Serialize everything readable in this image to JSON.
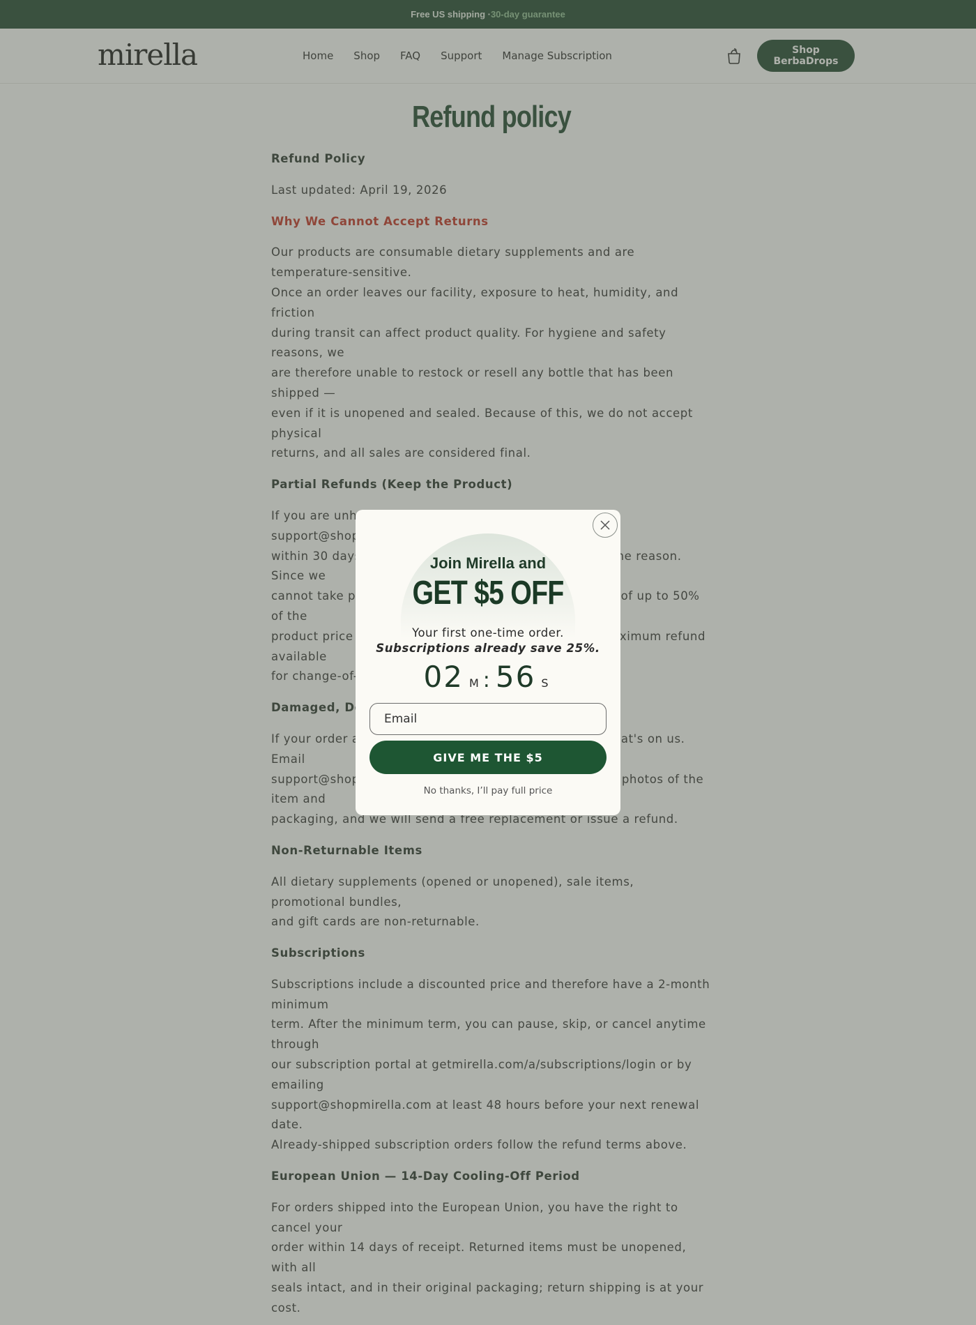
{
  "announcement": {
    "text": "Free US shipping · ",
    "highlight": "30-day guarantee"
  },
  "header": {
    "logo": "mirella",
    "nav": [
      "Home",
      "Shop",
      "FAQ",
      "Support",
      "Manage Subscription"
    ],
    "cart_icon": "shopping-bag-icon",
    "cta": "Shop BerbaDrops"
  },
  "page": {
    "title": "Refund policy",
    "heading": "Refund Policy",
    "last_updated": "Last updated: April 19, 2026",
    "sections": [
      {
        "heading": "Why We Cannot Accept Returns",
        "lines": [
          "Our products are consumable dietary supplements and are temperature-sensitive.",
          "Once an order leaves our facility, exposure to heat, humidity, and friction",
          "during transit can affect product quality. For hygiene and safety reasons, we",
          "are therefore unable to restock or resell any bottle that has been shipped —",
          "even if it is unopened and sealed. Because of this, we do not accept physical",
          "returns, and all sales are considered final."
        ]
      },
      {
        "heading": "Partial Refunds (Keep the Product)",
        "lines": [
          "If you are unhappy with your purchase, please email support@shopmirella.com",
          "within 30 days of delivery with your order number and the reason. Since we",
          "cannot take product back, we may offer a partial refund of up to 50% of the",
          "product price while you keep the product. This is the maximum refund available",
          "for change-of-mind requests."
        ]
      },
      {
        "heading": "Damaged, Defective or Incorrect Items",
        "lines": [
          "If your order arrives damaged, defective, or incorrect, that's on us. Email",
          "support@shopmirella.com within 7 days of delivery with photos of the item and",
          "packaging, and we will send a free replacement or issue a refund."
        ]
      },
      {
        "heading": "Non-Returnable Items",
        "lines": [
          "All dietary supplements (opened or unopened), sale items, promotional bundles,",
          "and gift cards are non-returnable."
        ]
      },
      {
        "heading": "Subscriptions",
        "lines": [
          "Subscriptions include a discounted price and therefore have a 2-month minimum",
          "term. After the minimum term, you can pause, skip, or cancel anytime through",
          "our subscription portal at getmirella.com/a/subscriptions/login or by emailing",
          "support@shopmirella.com at least 48 hours before your next renewal date.",
          "Already-shipped subscription orders follow the refund terms above."
        ]
      },
      {
        "heading": "European Union — 14-Day Cooling-Off Period",
        "lines": [
          "For orders shipped into the European Union, you have the right to cancel your",
          "order within 14 days of receipt. Returned items must be unopened, with all",
          "seals intact, and in their original packaging; return shipping is at your cost."
        ]
      }
    ]
  },
  "popup": {
    "join": "Join Mirella and",
    "offer": "GET $5 OFF",
    "sub1": "Your first one-time order.",
    "sub2": "Subscriptions already save 25%.",
    "minutes": "02",
    "minutes_unit": "M",
    "seconds": "56",
    "seconds_unit": "S",
    "email_placeholder": "Email",
    "submit": "GIVE ME THE $5",
    "decline": "No thanks, I’ll pay full price"
  }
}
